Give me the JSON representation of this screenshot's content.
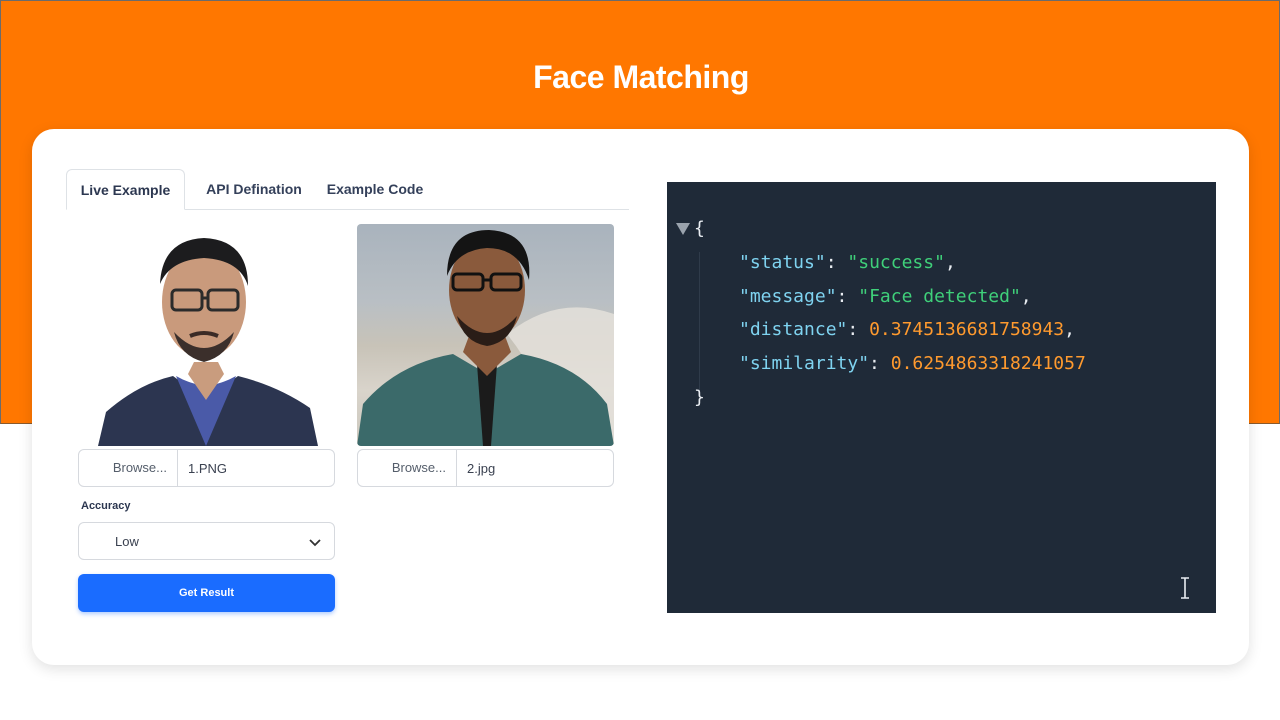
{
  "header": {
    "title": "Face Matching"
  },
  "tabs": [
    {
      "label": "Live Example",
      "active": true
    },
    {
      "label": "API Defination",
      "active": false
    },
    {
      "label": "Example Code",
      "active": false
    }
  ],
  "upload1": {
    "browse_label": "Browse...",
    "file_name": "1.PNG"
  },
  "upload2": {
    "browse_label": "Browse...",
    "file_name": "2.jpg"
  },
  "accuracy": {
    "label": "Accuracy",
    "selected": "Low"
  },
  "actions": {
    "get_result_label": "Get Result"
  },
  "result": {
    "open_brace": "{",
    "close_brace": "}",
    "status_key": "\"status\"",
    "status_value": "\"success\"",
    "message_key": "\"message\"",
    "message_value": "\"Face detected\"",
    "distance_key": "\"distance\"",
    "distance_value": "0.3745136681758943",
    "similarity_key": "\"similarity\"",
    "similarity_value": "0.6254863318241057"
  },
  "colors": {
    "brand": "#ff7700",
    "primary_button": "#1a6cff",
    "code_bg": "#1f2a38",
    "json_key": "#7fd3f0",
    "json_string": "#3fd07a",
    "json_number": "#ff9a2e"
  }
}
